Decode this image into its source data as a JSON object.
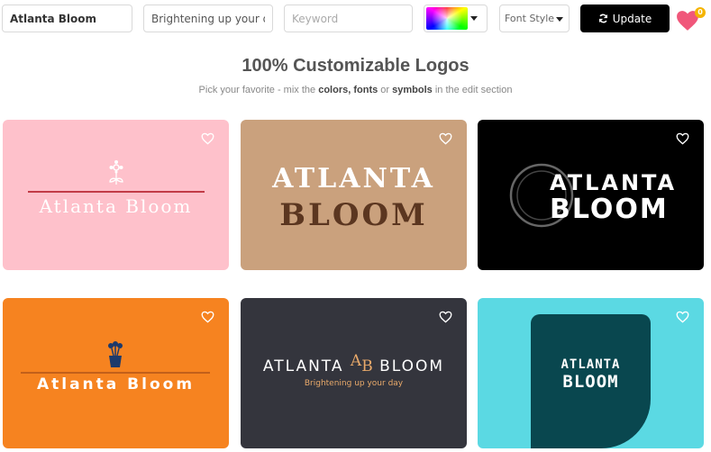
{
  "toolbar": {
    "name_value": "Atlanta Bloom",
    "slogan_value": "Brightening up your day",
    "keyword_placeholder": "Keyword",
    "font_style_label": "Font Style",
    "update_label": "Update",
    "favorites_count": "0"
  },
  "page": {
    "heading": "100% Customizable Logos",
    "subheading_prefix": "Pick your favorite - mix the ",
    "subheading_colors": "colors,",
    "subheading_fonts": "fonts",
    "subheading_or": " or ",
    "subheading_symbols": "symbols",
    "subheading_suffix": " in the edit section"
  },
  "logos": [
    {
      "name": "Atlanta Bloom",
      "background": "#fec1cb",
      "text_color": "#ffffff",
      "symbol": "flower-icon"
    },
    {
      "line1": "ATLANTA",
      "line2": "BLOOM",
      "background": "#caa17d",
      "text_color_1": "#ffffff",
      "text_color_2": "#5b3620"
    },
    {
      "line1": "ATLANTA",
      "line2": "BLOOM",
      "background": "#000000",
      "text_color": "#ffffff",
      "symbol": "circle-ring-icon"
    },
    {
      "name": "Atlanta Bloom",
      "background": "#f68320",
      "text_color": "#ffffff",
      "symbol": "flower-pot-icon"
    },
    {
      "left": "ATLANTA",
      "monogram_a": "A",
      "monogram_b": "B",
      "right": "BLOOM",
      "slogan": "Brightening up your day",
      "background": "#34353d",
      "accent": "#e8a96a"
    },
    {
      "line1": "ATLANTA",
      "line2": "BLOOM",
      "background": "#5bd9e3",
      "shape_color": "#09474f",
      "text_color": "#ffffff"
    }
  ],
  "colors": {
    "accent_heart": "#f0577a",
    "badge": "#f5b400",
    "button": "#000000"
  }
}
